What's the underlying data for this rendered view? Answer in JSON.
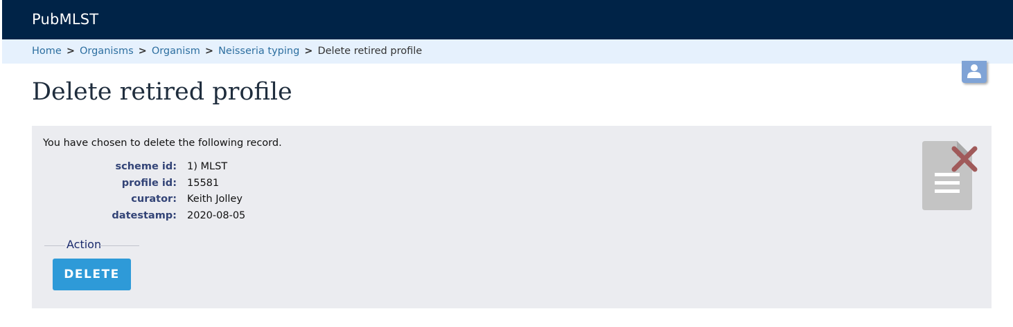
{
  "header": {
    "brand": "PubMLST"
  },
  "breadcrumb": {
    "items": [
      {
        "label": "Home"
      },
      {
        "label": "Organisms"
      },
      {
        "label": "Organism"
      },
      {
        "label": "Neisseria typing"
      }
    ],
    "separator": ">",
    "current": "Delete retired profile"
  },
  "page": {
    "title": "Delete retired profile"
  },
  "record": {
    "intro": "You have chosen to delete the following record.",
    "fields": [
      {
        "label": "scheme id:",
        "value": "1) MLST"
      },
      {
        "label": "profile id:",
        "value": "15581"
      },
      {
        "label": "curator:",
        "value": "Keith Jolley"
      },
      {
        "label": "datestamp:",
        "value": "2020-08-05"
      }
    ]
  },
  "action": {
    "legend": "Action",
    "delete_label": "DELETE"
  },
  "icons": {
    "user": "user-icon",
    "delete_document": "document-delete-icon"
  },
  "colors": {
    "header_bg": "#002347",
    "breadcrumb_bg": "#e6f1fd",
    "panel_bg": "#ebecf0",
    "button_bg": "#2e9ad8",
    "link": "#2d6fa0"
  }
}
